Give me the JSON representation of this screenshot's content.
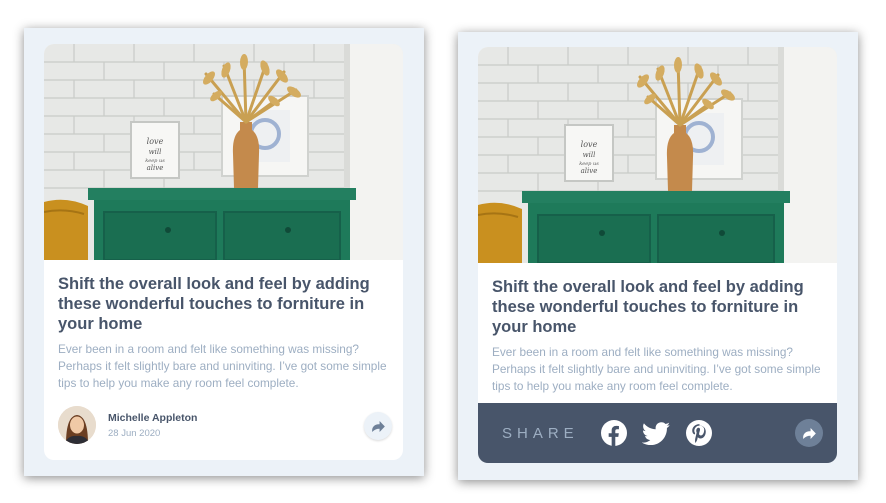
{
  "article": {
    "title": "Shift the overall look and feel by adding these wonderful touches to forniture in your home",
    "description": "Ever been in a room and felt like something was missing? Perhaps it felt slightly bare and uninviting. I’ve got some simple tips to help you make any room feel complete."
  },
  "author": {
    "name": "Michelle Appleton",
    "date": "28 Jun 2020"
  },
  "share": {
    "label": "SHARE",
    "networks": [
      "facebook-icon",
      "twitter-icon",
      "pinterest-icon"
    ]
  },
  "colors": {
    "dark_blue": "#48556a",
    "desaturated_blue": "#6e8098",
    "grayish_blue": "#9daec2",
    "light_grayish_blue": "#ecf2f8",
    "drawer_green": "#1e7a5a"
  },
  "photo": {
    "frame_text": "love will keep us alive"
  }
}
